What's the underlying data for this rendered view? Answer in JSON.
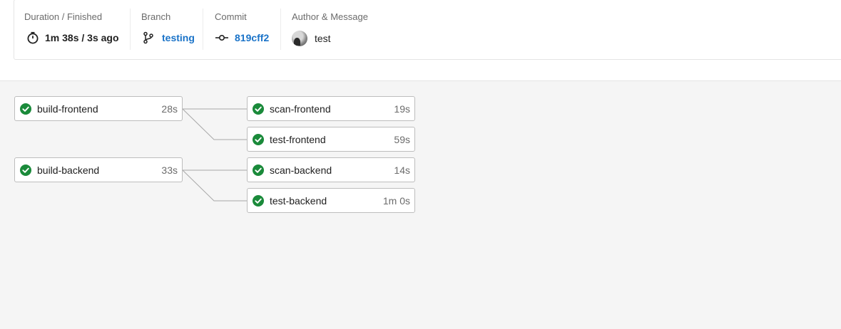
{
  "header": {
    "duration": {
      "label": "Duration / Finished",
      "value": "1m 38s / 3s ago",
      "icon": "timer-icon"
    },
    "branch": {
      "label": "Branch",
      "value": "testing",
      "icon": "git-branch-icon"
    },
    "commit": {
      "label": "Commit",
      "value": "819cff2",
      "icon": "git-commit-icon"
    },
    "author": {
      "label": "Author & Message",
      "message": "test",
      "icon": "avatar"
    }
  },
  "pipeline": {
    "stage1": [
      {
        "name": "build-frontend",
        "duration": "28s",
        "status": "success"
      },
      {
        "name": "build-backend",
        "duration": "33s",
        "status": "success"
      }
    ],
    "stage2": [
      {
        "name": "scan-frontend",
        "duration": "19s",
        "status": "success"
      },
      {
        "name": "test-frontend",
        "duration": "59s",
        "status": "success"
      },
      {
        "name": "scan-backend",
        "duration": "14s",
        "status": "success"
      },
      {
        "name": "test-backend",
        "duration": "1m 0s",
        "status": "success"
      }
    ]
  },
  "colors": {
    "success": "#1a8a3a",
    "link": "#1a73c8"
  }
}
